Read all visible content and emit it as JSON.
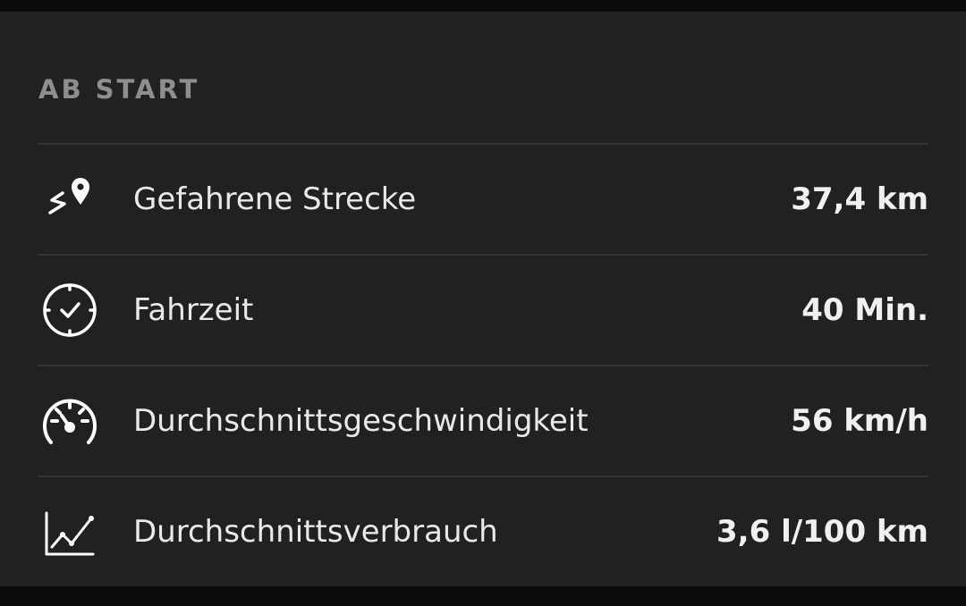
{
  "section": {
    "title": "AB START"
  },
  "stats": [
    {
      "icon": "route-pin-icon",
      "label": "Gefahrene Strecke",
      "value": "37,4 km"
    },
    {
      "icon": "clock-check-icon",
      "label": "Fahrzeit",
      "value": "40 Min."
    },
    {
      "icon": "speedometer-icon",
      "label": "Durchschnittsgeschwindigkeit",
      "value": "56 km/h"
    },
    {
      "icon": "line-chart-icon",
      "label": "Durchschnittsverbrauch",
      "value": "3,6 l/100 km"
    }
  ],
  "colors": {
    "background": "#0c0c0c",
    "panel": "#212121",
    "divider": "#353535",
    "title": "#8e8e8e",
    "text": "#e9e9e9"
  }
}
